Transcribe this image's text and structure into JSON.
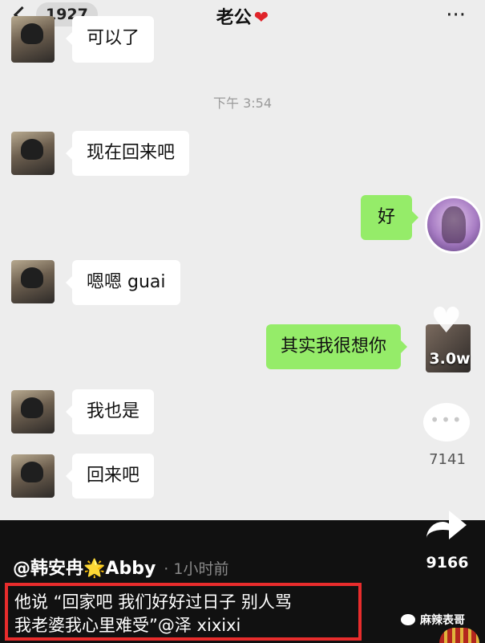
{
  "header": {
    "back_count": "1927",
    "title": "老公",
    "heart": "❤",
    "more": "···"
  },
  "messages": [
    {
      "side": "left",
      "text": "可以了"
    },
    {
      "side": "time",
      "text": "下午 3:54"
    },
    {
      "side": "left",
      "text": "现在回来吧"
    },
    {
      "side": "right",
      "text": "好"
    },
    {
      "side": "left",
      "text": "嗯嗯 guai"
    },
    {
      "side": "right",
      "text": "其实我很想你"
    },
    {
      "side": "left",
      "text": "我也是"
    },
    {
      "side": "left",
      "text": "回来吧"
    }
  ],
  "video": {
    "like_count": "3.0w",
    "comment_count": "7141",
    "share_count": "9166",
    "author": "@韩安冉",
    "author_star": "🌟",
    "author_suffix": "Abby",
    "time_ago": "· 1小时前",
    "caption_line1": "他说 “回家吧 我们好好过日子 别人骂",
    "caption_line2": "我老婆我心里难受”@泽 xixixi",
    "watermark": "麻辣表哥"
  },
  "colors": {
    "chat_bg": "#ededed",
    "sent_bubble": "#95ec69",
    "received_bubble": "#ffffff",
    "caption_border": "#e82c2c"
  }
}
